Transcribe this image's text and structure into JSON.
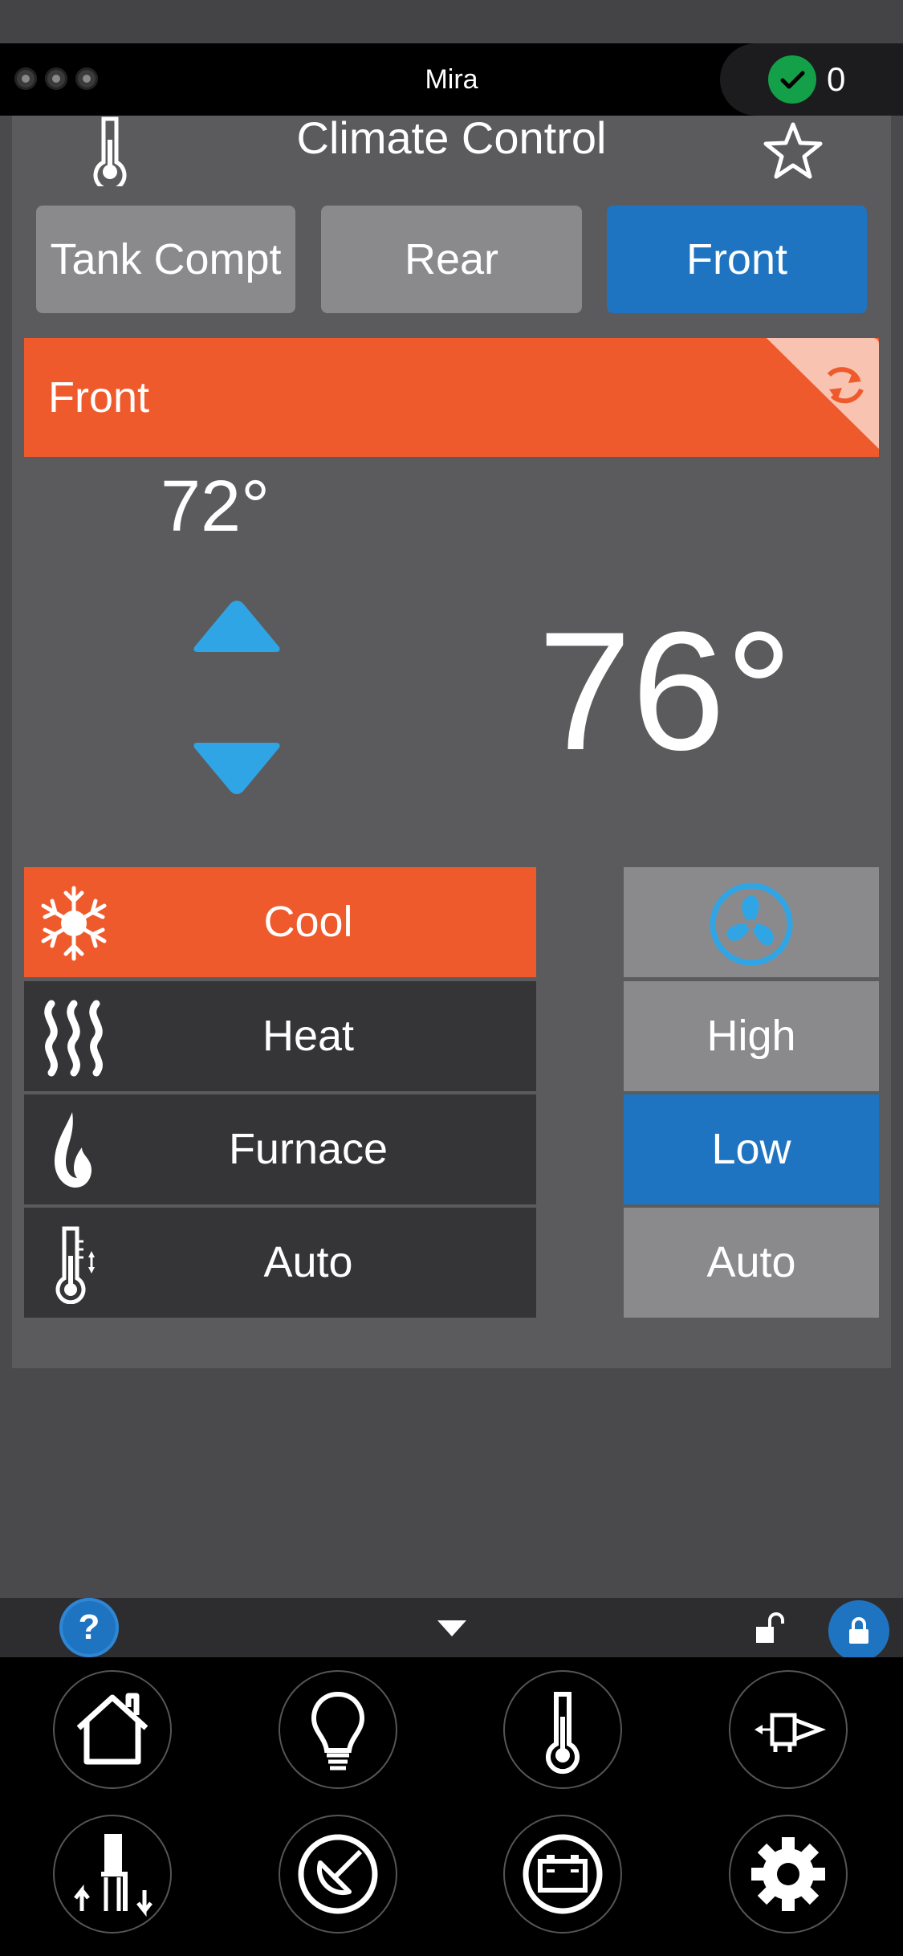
{
  "app": {
    "title": "Mira",
    "check_count": "0"
  },
  "page": {
    "title": "Climate Control"
  },
  "zones": [
    {
      "label": "Tank Compt",
      "active": false
    },
    {
      "label": "Rear",
      "active": false
    },
    {
      "label": "Front",
      "active": true
    }
  ],
  "zone_bar": {
    "label": "Front"
  },
  "setpoint": "72°",
  "current_temp": "76°",
  "modes": [
    {
      "label": "Cool",
      "icon": "snowflake-icon",
      "active": true
    },
    {
      "label": "Heat",
      "icon": "heat-waves-icon",
      "active": false
    },
    {
      "label": "Furnace",
      "icon": "flame-icon",
      "active": false
    },
    {
      "label": "Auto",
      "icon": "thermometer-auto-icon",
      "active": false
    }
  ],
  "fan": {
    "icon": "fan-icon",
    "speeds": [
      {
        "label": "High",
        "active": false
      },
      {
        "label": "Low",
        "active": true
      },
      {
        "label": "Auto",
        "active": false
      }
    ]
  },
  "toolbar": {
    "help_label": "?"
  },
  "nav": [
    "home-icon",
    "lightbulb-icon",
    "thermometer-icon",
    "slide-out-icon",
    "leveling-icon",
    "satellite-icon",
    "battery-icon",
    "gear-icon"
  ],
  "colors": {
    "accent_orange": "#ef5a2c",
    "accent_blue": "#1f74c2",
    "arrow_blue": "#2fa5e6",
    "check_green": "#14a048"
  }
}
